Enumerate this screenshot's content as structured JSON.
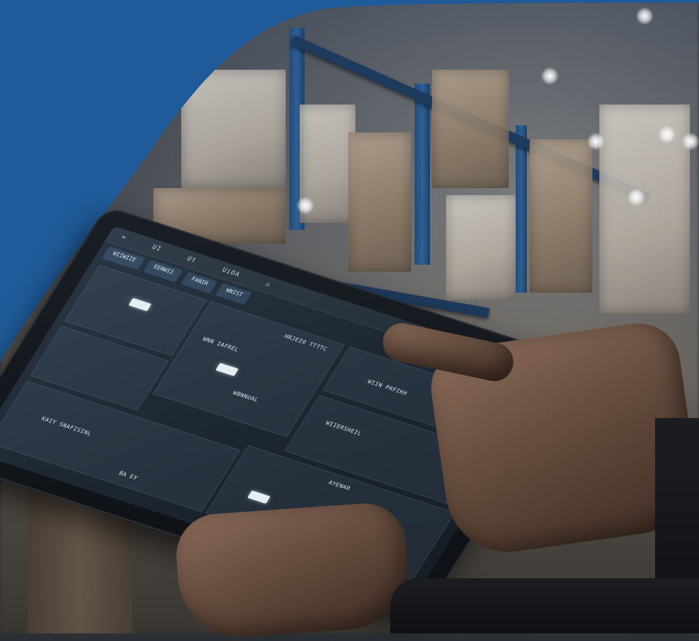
{
  "colors": {
    "brand_blue": "#1f5b9a",
    "shelf_blue": "#234b78"
  },
  "tablet_ui": {
    "topbar": [
      "≈",
      "UI",
      "Ut",
      "UіOА",
      "△"
    ],
    "tabs": [
      "WIIWIIЕ",
      "EENWII",
      "FANIR",
      "WNIST"
    ],
    "labels": [
      "HRJEIO TTTTC",
      "WNN IAFREL",
      "WIIN PRFIKH",
      "WBNNUAL",
      "WIIERSHEIL",
      "AYENAR",
      "KAIY SNAFISINL",
      "ВА ЕУ"
    ]
  },
  "icons": [
    "wifi-icon",
    "menu-icon"
  ]
}
